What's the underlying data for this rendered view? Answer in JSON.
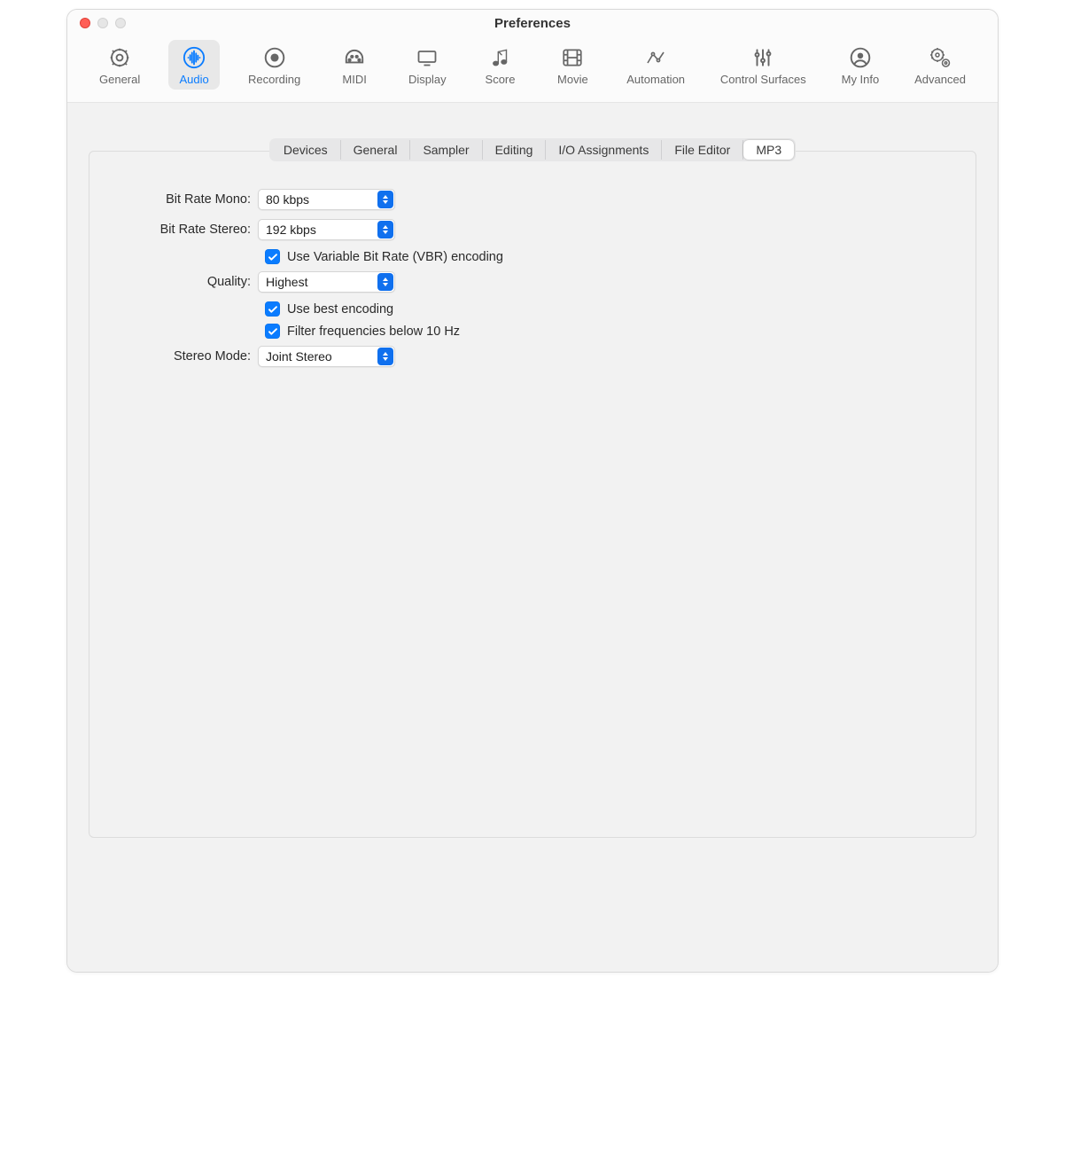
{
  "window": {
    "title": "Preferences"
  },
  "toolbar": {
    "items": [
      {
        "label": "General"
      },
      {
        "label": "Audio"
      },
      {
        "label": "Recording"
      },
      {
        "label": "MIDI"
      },
      {
        "label": "Display"
      },
      {
        "label": "Score"
      },
      {
        "label": "Movie"
      },
      {
        "label": "Automation"
      },
      {
        "label": "Control Surfaces"
      },
      {
        "label": "My Info"
      },
      {
        "label": "Advanced"
      }
    ],
    "selected_index": 1
  },
  "subtabs": {
    "items": [
      "Devices",
      "General",
      "Sampler",
      "Editing",
      "I/O Assignments",
      "File Editor",
      "MP3"
    ],
    "active_index": 6
  },
  "form": {
    "bit_rate_mono": {
      "label": "Bit Rate Mono:",
      "value": "80 kbps"
    },
    "bit_rate_stereo": {
      "label": "Bit Rate Stereo:",
      "value": "192 kbps"
    },
    "vbr": {
      "checked": true,
      "label": "Use Variable Bit Rate (VBR) encoding"
    },
    "quality": {
      "label": "Quality:",
      "value": "Highest"
    },
    "best_encoding": {
      "checked": true,
      "label": "Use best encoding"
    },
    "filter_freq": {
      "checked": true,
      "label": "Filter frequencies below 10 Hz"
    },
    "stereo_mode": {
      "label": "Stereo Mode:",
      "value": "Joint Stereo"
    }
  }
}
